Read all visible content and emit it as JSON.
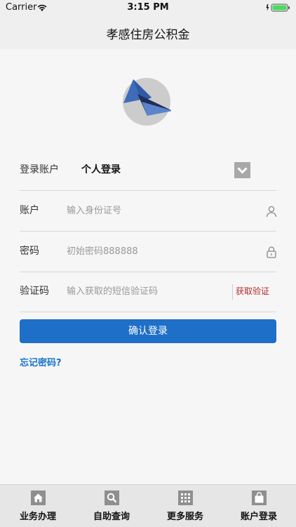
{
  "status_bar": {
    "carrier": "Carrier",
    "time": "3:15 PM"
  },
  "nav": {
    "title": "孝感住房公积金"
  },
  "form": {
    "account_type": {
      "label": "登录账户",
      "value": "个人登录"
    },
    "account": {
      "label": "账户",
      "placeholder": "输入身份证号"
    },
    "password": {
      "label": "密码",
      "placeholder": "初始密码888888"
    },
    "code": {
      "label": "验证码",
      "placeholder": "输入获取的短信验证码",
      "get_code_label": "获取验证码"
    },
    "confirm_label": "确认登录",
    "forgot_label": "忘记密码?"
  },
  "tabs": [
    {
      "label": "业务办理",
      "icon": "home-icon"
    },
    {
      "label": "自助查询",
      "icon": "search-icon"
    },
    {
      "label": "更多服务",
      "icon": "grid-icon"
    },
    {
      "label": "账户登录",
      "icon": "bag-icon"
    }
  ],
  "colors": {
    "primary": "#1e6fc8",
    "link": "#1a73c9",
    "get_code": "#b4292d",
    "battery": "#4cd964"
  }
}
